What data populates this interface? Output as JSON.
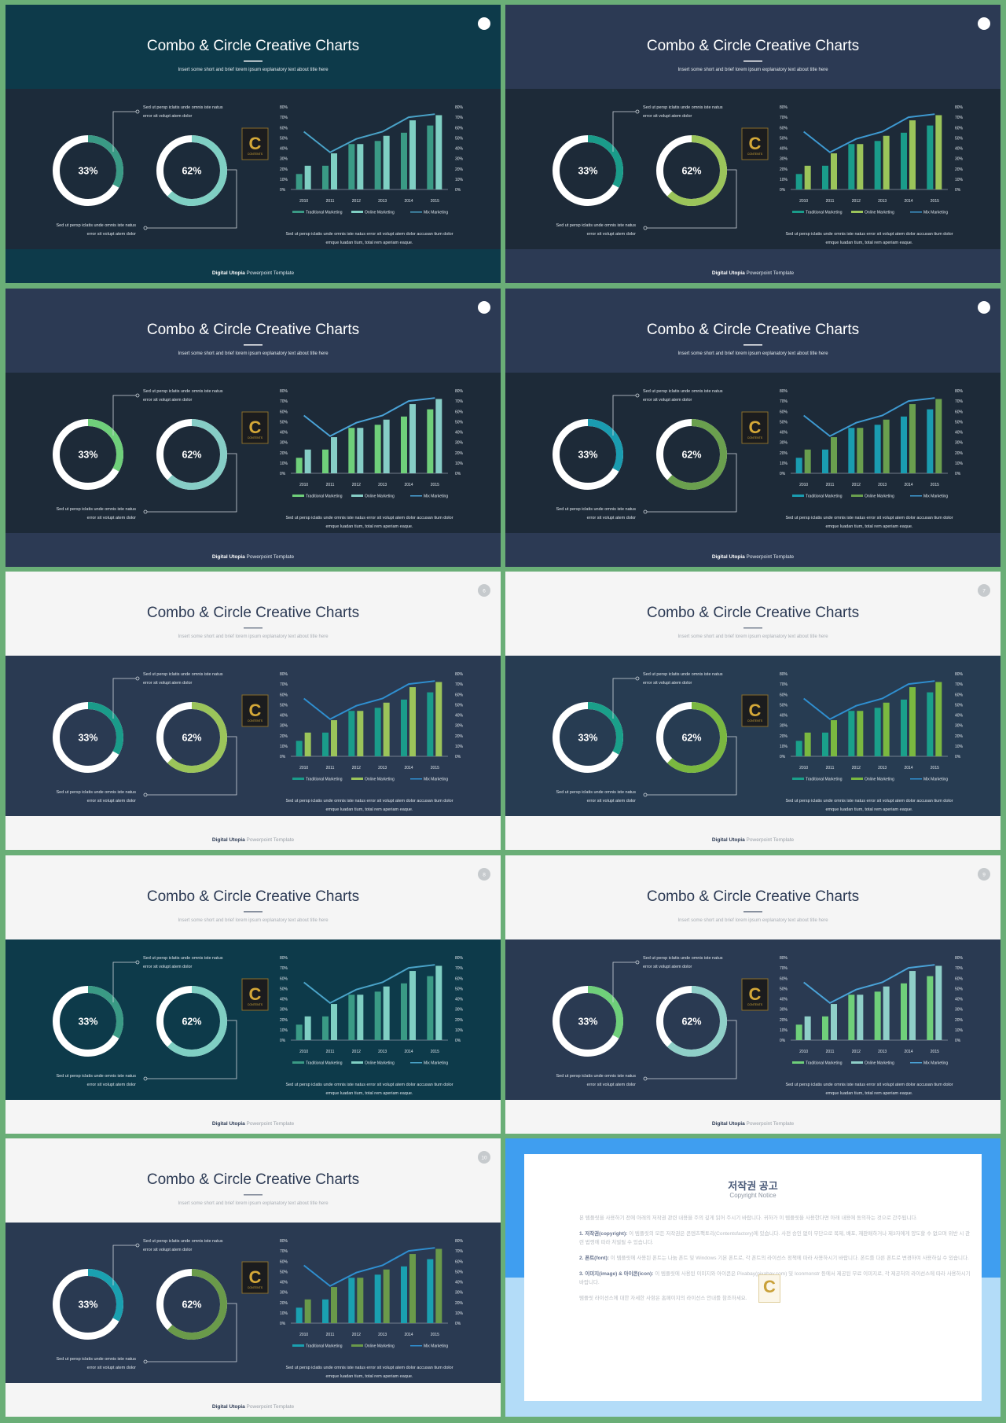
{
  "content": {
    "title": "Combo & Circle Creative Charts",
    "subtitle": "Insert some short and brief lorem ipsum explanatory text about title here",
    "callout_top": [
      "Sed ut persp  iclatis unde omnis  iste natus",
      "error  sit volupt atem dolor"
    ],
    "callout_bottom": [
      "Sed ut persp  iclatis unde omnis  iste natus",
      "error  sit volupt atem dolor"
    ],
    "chart_caption": [
      "Sed ut persp  iclatis unde omnis  iste natus error  sit volupt  atem dolor  accusan tium  dolor",
      "emque  luadan tium,  total  rem aperiam  eaque."
    ],
    "donuts": [
      {
        "label": "33%",
        "value": 33
      },
      {
        "label": "62%",
        "value": 62
      }
    ],
    "footer_brand": "Digital Utopia",
    "footer_rest": " Powerpoint Template",
    "logo_text": "C",
    "logo_subtext": "CONTENTS"
  },
  "chart_data": {
    "type": "bar",
    "categories": [
      "2010",
      "2011",
      "2012",
      "2013",
      "2014",
      "2015"
    ],
    "series": [
      {
        "name": "Traditional Marketing",
        "type": "bar",
        "values": [
          15,
          23,
          44,
          47,
          55,
          62
        ]
      },
      {
        "name": "Online Marketing",
        "type": "bar",
        "values": [
          23,
          35,
          44,
          52,
          67,
          72
        ]
      },
      {
        "name": "Mix Marketing",
        "type": "line",
        "values": [
          56,
          36,
          49,
          56,
          70,
          73
        ]
      }
    ],
    "yticks": [
      "0%",
      "10%",
      "20%",
      "30%",
      "40%",
      "50%",
      "60%",
      "70%",
      "80%"
    ],
    "ylim": [
      0,
      80
    ],
    "secondary_axis": true,
    "grid": false,
    "legend": "bottom"
  },
  "slides": [
    {
      "header": "#0d3a4a",
      "band": "#1c2b3a",
      "footer": "#0d3a4a",
      "light": false,
      "trad": "#3a9a85",
      "online": "#7fcfc3",
      "line": "#4aa3c8",
      "page": ""
    },
    {
      "header": "#2c3a54",
      "band": "#1d2a38",
      "footer": "#2c3a54",
      "light": false,
      "trad": "#1a9c8a",
      "online": "#9bc45a",
      "line": "#3e9ad2",
      "page": ""
    },
    {
      "header": "#2c3a54",
      "band": "#1d2a38",
      "footer": "#2c3a54",
      "light": false,
      "trad": "#6fcf7a",
      "online": "#86cdc6",
      "line": "#4aa3d8",
      "page": ""
    },
    {
      "header": "#2c3a54",
      "band": "#1d2a38",
      "footer": "#2c3a54",
      "light": false,
      "trad": "#1a9cb0",
      "online": "#6a9f4e",
      "line": "#3e9ad2",
      "page": ""
    },
    {
      "header": "#f5f5f5",
      "band": "#2a3a52",
      "footer": "#f5f5f5",
      "light": true,
      "trad": "#1a9c8a",
      "online": "#9bc45a",
      "line": "#2f8fd0",
      "page": "6"
    },
    {
      "header": "#f5f5f5",
      "band": "#273c52",
      "footer": "#f5f5f5",
      "light": true,
      "trad": "#1aa08a",
      "online": "#7ab840",
      "line": "#2f8fd0",
      "page": "7"
    },
    {
      "header": "#f5f5f5",
      "band": "#0d3a4a",
      "footer": "#f5f5f5",
      "light": true,
      "trad": "#3a9a85",
      "online": "#7fcfc3",
      "line": "#4aa3c8",
      "page": "8"
    },
    {
      "header": "#f5f5f5",
      "band": "#2a3a52",
      "footer": "#f5f5f5",
      "light": true,
      "trad": "#6fcf7a",
      "online": "#8fcfc8",
      "line": "#4aa3d8",
      "page": "9"
    },
    {
      "header": "#f5f5f5",
      "band": "#2a3a52",
      "footer": "#f5f5f5",
      "light": true,
      "trad": "#1aa0b0",
      "online": "#6a9a4a",
      "line": "#2f8fd0",
      "page": "10"
    }
  ],
  "copyright": {
    "title": "저작권 공고",
    "subtitle": "Copyright Notice",
    "intro": "본 템플릿을 사용하기 전에 아래의 저작권 관련 내용을 주의 깊게 읽어 주시기 바랍니다. 귀하가 이 템플릿을 사용한다면 아래 내용에 동의하는 것으로 간주됩니다.",
    "sections": [
      {
        "head": "1. 저작권(copyright): ",
        "text": "이 템플릿의 모든 저작권은 콘텐츠팩토리(Contentsfactory)에 있습니다. 사전 승인 없이 무단으로 복제, 배포, 재판매하거나 제3자에게 양도할 수 없으며 위반 시 관련 법령에 따라 처벌될 수 있습니다."
      },
      {
        "head": "2. 폰트(font): ",
        "text": "이 템플릿에 사용된 폰트는 나눔 폰트 및 Windows 기본 폰트로, 각 폰트의 라이선스 정책에 따라 사용하시기 바랍니다. 폰트를 다른 폰트로 변경하여 사용하실 수 있습니다."
      },
      {
        "head": "3. 이미지(image) & 아이콘(icon): ",
        "text": "이 템플릿에 사용된 이미지와 아이콘은 Pixabay(pixabay.com) 및 Iconmonstr 등에서 제공된 무료 이미지로, 각 제공처의 라이선스에 따라 사용하시기 바랍니다."
      }
    ],
    "closing": "템플릿 라이선스에 대한 자세한 사항은 홈페이지의 라이선스 안내를 참조하세요.",
    "watermark": "C"
  }
}
